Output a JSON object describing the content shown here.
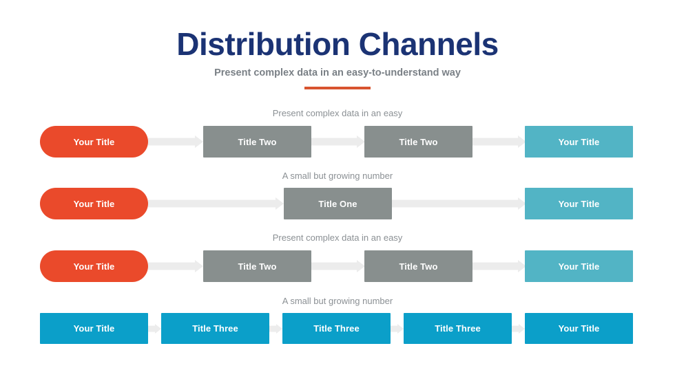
{
  "header": {
    "title": "Distribution Channels",
    "subtitle": "Present complex data in an easy-to-understand way",
    "divider_color": "#d8542f",
    "title_color": "#1b3374",
    "subtitle_color": "#7a8086"
  },
  "palette": {
    "orange": "#ea4a2b",
    "teal": "#52b4c5",
    "gray": "#888f8e",
    "blue": "#0b9fc9",
    "arrow": "#ececec"
  },
  "rows": [
    {
      "label": "Present complex data in an easy",
      "nodes": [
        {
          "text": "Your Title",
          "color": "#ea4a2b",
          "shape": "pill"
        },
        {
          "text": "Title Two",
          "color": "#888f8e",
          "shape": "sq"
        },
        {
          "text": "Title Two",
          "color": "#888f8e",
          "shape": "sq"
        },
        {
          "text": "Your Title",
          "color": "#52b4c5",
          "shape": "sq"
        }
      ]
    },
    {
      "label": "A small but growing number",
      "nodes": [
        {
          "text": "Your Title",
          "color": "#ea4a2b",
          "shape": "pill"
        },
        {
          "text": "Title One",
          "color": "#888f8e",
          "shape": "sq"
        },
        {
          "text": "Your Title",
          "color": "#52b4c5",
          "shape": "sq"
        }
      ]
    },
    {
      "label": "Present complex data in an easy",
      "nodes": [
        {
          "text": "Your Title",
          "color": "#ea4a2b",
          "shape": "pill"
        },
        {
          "text": "Title Two",
          "color": "#888f8e",
          "shape": "sq"
        },
        {
          "text": "Title Two",
          "color": "#888f8e",
          "shape": "sq"
        },
        {
          "text": "Your Title",
          "color": "#52b4c5",
          "shape": "sq"
        }
      ]
    },
    {
      "label": "A small but growing number",
      "nodes": [
        {
          "text": "Your Title",
          "color": "#0b9fc9",
          "shape": "sq"
        },
        {
          "text": "Title Three",
          "color": "#0b9fc9",
          "shape": "sq"
        },
        {
          "text": "Title Three",
          "color": "#0b9fc9",
          "shape": "sq"
        },
        {
          "text": "Title Three",
          "color": "#0b9fc9",
          "shape": "sq"
        },
        {
          "text": "Your Title",
          "color": "#0b9fc9",
          "shape": "sq"
        }
      ]
    }
  ]
}
